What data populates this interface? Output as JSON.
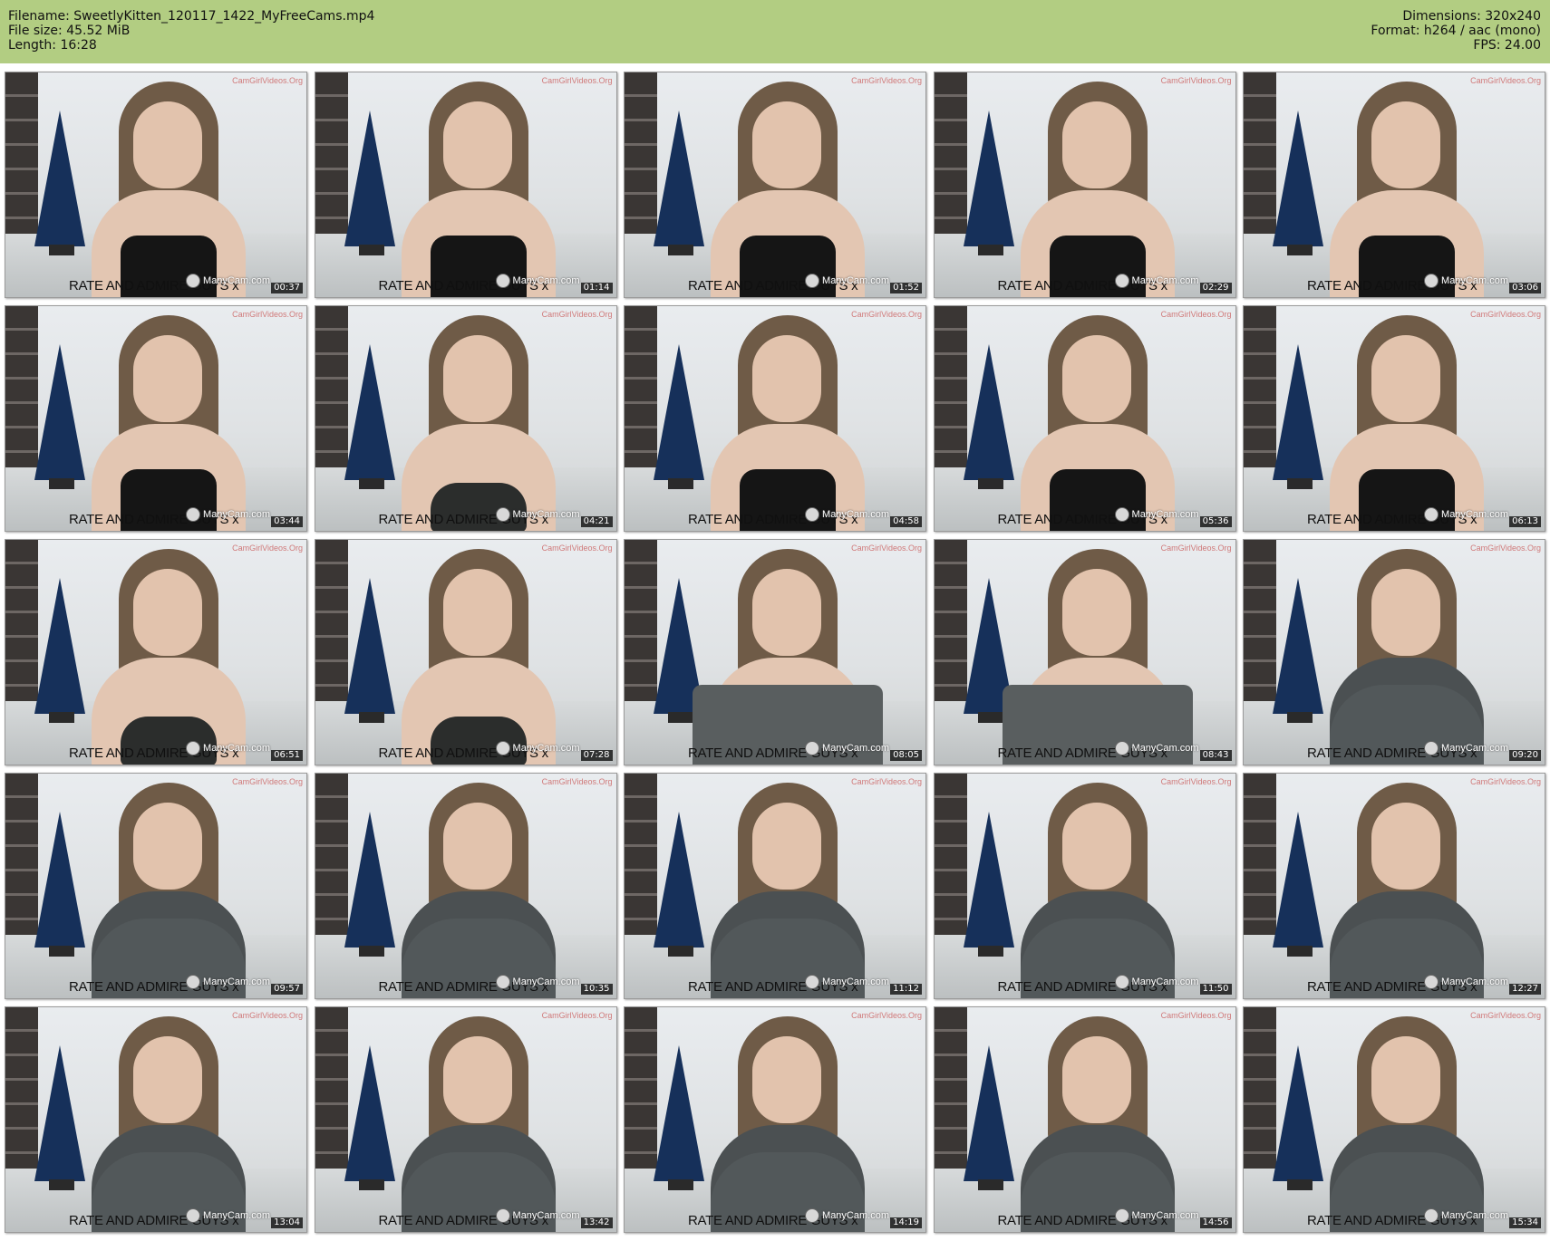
{
  "header": {
    "filename": "Filename: SweetlyKitten_120117_1422_MyFreeCams.mp4",
    "filesize": "File size: 45.52 MiB",
    "length": "Length: 16:28",
    "dimensions": "Dimensions: 320x240",
    "format": "Format: h264 / aac (mono)",
    "fps": "FPS: 24.00",
    "background_color": "#b2cd82"
  },
  "overlay": {
    "caption": "RATE AND ADMIRE GUYS x",
    "logo": "ManyCam.com",
    "watermark": "CamGirlVideos.Org"
  },
  "thumbnails": [
    {
      "time": "00:37",
      "outfit": "tank"
    },
    {
      "time": "01:14",
      "outfit": "tank"
    },
    {
      "time": "01:52",
      "outfit": "tank"
    },
    {
      "time": "02:29",
      "outfit": "tank"
    },
    {
      "time": "03:06",
      "outfit": "tank"
    },
    {
      "time": "03:44",
      "outfit": "tank"
    },
    {
      "time": "04:21",
      "outfit": "bra"
    },
    {
      "time": "04:58",
      "outfit": "tank"
    },
    {
      "time": "05:36",
      "outfit": "tank"
    },
    {
      "time": "06:13",
      "outfit": "tank"
    },
    {
      "time": "06:51",
      "outfit": "bra"
    },
    {
      "time": "07:28",
      "outfit": "bra"
    },
    {
      "time": "08:05",
      "outfit": "wrap"
    },
    {
      "time": "08:43",
      "outfit": "wrap"
    },
    {
      "time": "09:20",
      "outfit": "sweater"
    },
    {
      "time": "09:57",
      "outfit": "sweater"
    },
    {
      "time": "10:35",
      "outfit": "sweater"
    },
    {
      "time": "11:12",
      "outfit": "sweater"
    },
    {
      "time": "11:50",
      "outfit": "sweater"
    },
    {
      "time": "12:27",
      "outfit": "sweater"
    },
    {
      "time": "13:04",
      "outfit": "sweater"
    },
    {
      "time": "13:42",
      "outfit": "sweater"
    },
    {
      "time": "14:19",
      "outfit": "sweater"
    },
    {
      "time": "14:56",
      "outfit": "sweater"
    },
    {
      "time": "15:34",
      "outfit": "sweater"
    }
  ]
}
